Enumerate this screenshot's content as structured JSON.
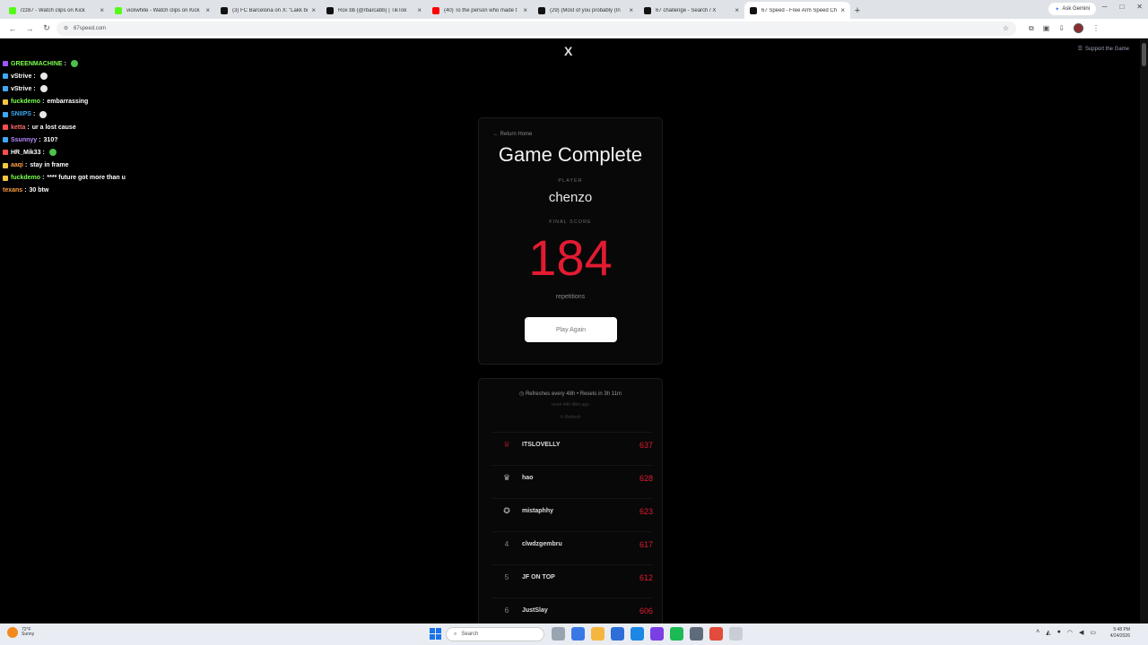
{
  "browser": {
    "tabs": [
      {
        "label": "rzz87 - Watch clips on Kick",
        "color": "#53fc18"
      },
      {
        "label": "vickwhite - Watch clips on Kick",
        "color": "#53fc18"
      },
      {
        "label": "(3) FC Barcelona on X: \"Lakk bi",
        "color": "#111111"
      },
      {
        "label": "Rox bb (@rbarcabb) | TikTok",
        "color": "#111111"
      },
      {
        "label": "(40) To the person who made t",
        "color": "#ff0000"
      },
      {
        "label": "(29) (Most of you probably (In",
        "color": "#111111"
      },
      {
        "label": "67 challenge - Search / X",
        "color": "#111111"
      },
      {
        "label": "67 Speed - Free Arm Speed Ch",
        "color": "#111111"
      }
    ],
    "active_tab": 7,
    "tab_close": "×",
    "new_tab": "+",
    "ask_gemini": "Ask Gemini",
    "url": "67speed.com"
  },
  "page": {
    "x_logo": "X",
    "support": "Support the Game",
    "card": {
      "return_home": "← Return Home",
      "title": "Game Complete",
      "player_label": "PLAYER",
      "player_name": "chenzo",
      "score_label": "FINAL SCORE",
      "score": "184",
      "score_unit": "repetitions",
      "play_again": "Play Again"
    },
    "leaderboard": {
      "refresh_text": "Refreshes every 48h • Resets in 3h 11m",
      "reset_ago": "reset 44h 48m ago",
      "refresh_button": "Refresh",
      "rows": [
        {
          "rank": "1",
          "name": "ITSLOVELLY",
          "score": "637",
          "icon": "trophy-icon"
        },
        {
          "rank": "2",
          "name": "hao",
          "score": "628",
          "icon": "medal-icon"
        },
        {
          "rank": "3",
          "name": "mistaphhy",
          "score": "623",
          "icon": "award-icon"
        },
        {
          "rank": "4",
          "name": "clwdzgembru",
          "score": "617",
          "icon": ""
        },
        {
          "rank": "5",
          "name": "JF ON TOP",
          "score": "612",
          "icon": ""
        },
        {
          "rank": "6",
          "name": "JustSlay",
          "score": "606",
          "icon": ""
        }
      ]
    }
  },
  "chat": [
    {
      "name": "GREENMACHINE",
      "message": "",
      "name_color": "#7cff4e",
      "badge_color": "#9b59ff",
      "emote": "green"
    },
    {
      "name": "vStrive",
      "message": "",
      "name_color": "#ffffff",
      "badge_color": "#3fa9f5",
      "emote": "white"
    },
    {
      "name": "vStrive",
      "message": "",
      "name_color": "#ffffff",
      "badge_color": "#3fa9f5",
      "emote": "white"
    },
    {
      "name": "fuckdemo",
      "message": "embarrassing",
      "name_color": "#7cff4e",
      "badge_color": "#f5c542",
      "emote": ""
    },
    {
      "name": "SNIIPS",
      "message": "",
      "name_color": "#3fa9f5",
      "badge_color": "#3fa9f5",
      "emote": "white"
    },
    {
      "name": "ketta",
      "message": "ur a lost cause",
      "name_color": "#ff6b6b",
      "badge_color": "#ff4d4d",
      "emote": ""
    },
    {
      "name": "Ssunnyy",
      "message": "310?",
      "name_color": "#b98cff",
      "badge_color": "#3fa9f5",
      "emote": ""
    },
    {
      "name": "HR_Mik33",
      "message": "",
      "name_color": "#ffffff",
      "badge_color": "#ff4d4d",
      "emote": "green"
    },
    {
      "name": "aaqi",
      "message": "stay in frame",
      "name_color": "#ff9f43",
      "badge_color": "#f5c542",
      "emote": ""
    },
    {
      "name": "fuckdemo",
      "message": "**** future got more than u",
      "name_color": "#7cff4e",
      "badge_color": "#f5c542",
      "emote": ""
    },
    {
      "name": "texans",
      "message": "30 btw",
      "name_color": "#ff9f43",
      "badge_color": "",
      "emote": ""
    }
  ],
  "taskbar": {
    "weather_temp": "72°F",
    "weather_desc": "Sunny",
    "search": "Search",
    "time": "5:48 PM",
    "date": "4/24/2026"
  }
}
